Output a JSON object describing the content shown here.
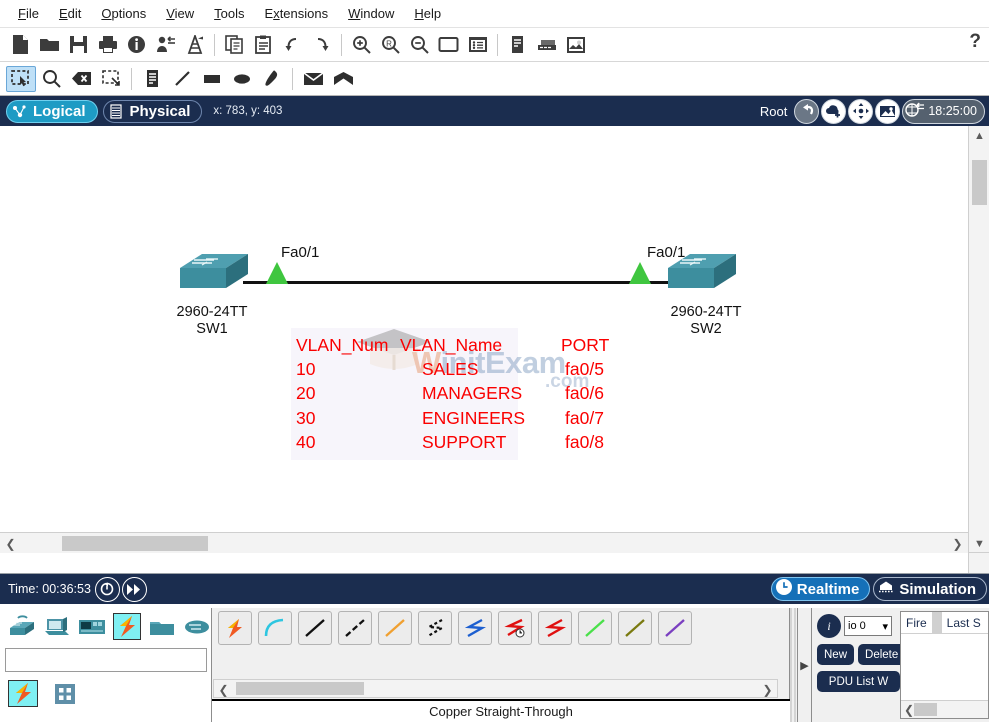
{
  "menu": {
    "items": [
      {
        "label": "File",
        "mnemonic": "F"
      },
      {
        "label": "Edit",
        "mnemonic": "E"
      },
      {
        "label": "Options",
        "mnemonic": "O"
      },
      {
        "label": "View",
        "mnemonic": "V"
      },
      {
        "label": "Tools",
        "mnemonic": "T"
      },
      {
        "label": "Extensions",
        "mnemonic": "x"
      },
      {
        "label": "Window",
        "mnemonic": "W"
      },
      {
        "label": "Help",
        "mnemonic": "H"
      }
    ],
    "help_glyph": "?"
  },
  "toolbar_main": {
    "icons": [
      "new-file-icon",
      "open-folder-icon",
      "save-icon",
      "print-icon",
      "activity-wizard-icon",
      "network-info-icon",
      "custom-devices-icon",
      "copy-icon",
      "paste-icon",
      "undo-icon",
      "redo-icon",
      "zoom-in-icon",
      "zoom-reset-icon",
      "zoom-out-icon",
      "palette-icon",
      "custom-devices-dialog-icon",
      "toolbar-list-icon",
      "toolbar-device-icon",
      "toolbar-image-icon"
    ]
  },
  "toolbar_tools": {
    "icons": [
      "select-icon",
      "inspect-icon",
      "delete-icon",
      "resize-shape-icon",
      "place-note-icon",
      "draw-line-icon",
      "draw-rectangle-icon",
      "draw-ellipse-icon",
      "draw-freeform-icon",
      "simple-pdu-icon",
      "complex-pdu-icon"
    ],
    "selected": "select-icon"
  },
  "view_bar": {
    "tabs": [
      {
        "label": "Logical",
        "icon": "logical-icon",
        "active": true
      },
      {
        "label": "Physical",
        "icon": "physical-icon",
        "active": false
      }
    ],
    "coordinates": "x: 783, y: 403",
    "root_label": "Root",
    "buttons": [
      "back-icon",
      "new-cluster-icon",
      "move-object-icon",
      "set-tiled-background-icon"
    ],
    "clock_time": "18:25:00",
    "clock_icon": "viewport-clock-icon"
  },
  "canvas": {
    "devices": [
      {
        "id": "SW1",
        "model": "2960-24TT",
        "name": "SW1",
        "port_label": "Fa0/1",
        "link_state": "up"
      },
      {
        "id": "SW2",
        "model": "2960-24TT",
        "name": "SW2",
        "port_label": "Fa0/1",
        "link_state": "up"
      }
    ],
    "link": {
      "type": "Copper Straight-Through",
      "from": "SW1",
      "to": "SW2"
    },
    "vlan_table": {
      "headers": [
        "VLAN_Num",
        "VLAN_Name",
        "PORT"
      ],
      "rows": [
        [
          "10",
          "SALES",
          "fa0/5"
        ],
        [
          "20",
          "MANAGERS",
          "fa0/6"
        ],
        [
          "30",
          "ENGINEERS",
          "fa0/7"
        ],
        [
          "40",
          "SUPPORT",
          "fa0/8"
        ]
      ],
      "text_color": "#fa0000"
    },
    "watermark": {
      "text_a": "W",
      "text_b": "initExam",
      "text_c": ".com",
      "icon": "graduation-cap-icon"
    }
  },
  "sim_bar": {
    "time_label": "Time: 00:36:53",
    "reset_icon": "power-cycle-devices-icon",
    "fast_forward_icon": "fast-forward-time-icon",
    "modes": [
      {
        "label": "Realtime",
        "icon": "clock-icon",
        "active": true
      },
      {
        "label": "Simulation",
        "icon": "simulation-icon",
        "active": false
      }
    ]
  },
  "device_panel": {
    "categories": [
      {
        "name": "network-devices",
        "selected": false
      },
      {
        "name": "end-devices",
        "selected": false
      },
      {
        "name": "components",
        "selected": false
      },
      {
        "name": "connections",
        "selected": true
      },
      {
        "name": "miscellaneous",
        "selected": false
      },
      {
        "name": "multiuser",
        "selected": false
      }
    ],
    "search_value": "",
    "search_placeholder": "",
    "subcategories": [
      {
        "name": "connections-sub",
        "selected": true
      },
      {
        "name": "grid-view-sub",
        "selected": false
      }
    ]
  },
  "connections_panel": {
    "items": [
      "automatically-choose-connection-icon",
      "console-cable-icon",
      "copper-straight-through-icon",
      "copper-cross-over-icon",
      "fiber-cable-icon",
      "phone-cable-icon",
      "coaxial-cable-icon",
      "serial-dce-icon",
      "serial-dte-icon",
      "octal-cable-icon",
      "iot-custom-cable-icon",
      "usb-cable-icon"
    ],
    "status_label": "Copper Straight-Through"
  },
  "pdu_panel": {
    "info_icon": "info-icon",
    "scenario_value": "io 0",
    "new_label": "New",
    "delete_label": "Delete",
    "toggle_label": "PDU List W",
    "table_headers": [
      "Fire",
      "Last S"
    ]
  }
}
